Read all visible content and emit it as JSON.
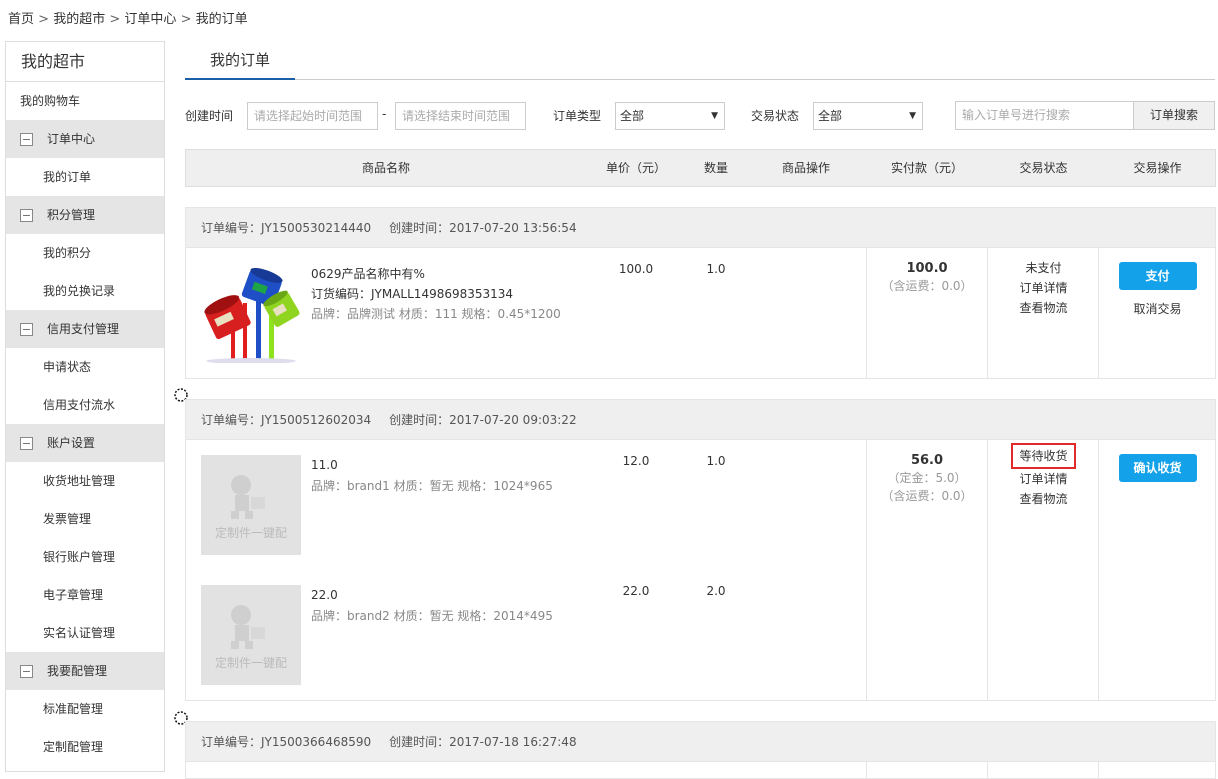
{
  "breadcrumb": [
    "首页",
    "我的超市",
    "订单中心",
    "我的订单"
  ],
  "sidebar": {
    "title": "我的超市",
    "cart": "我的购物车",
    "groups": [
      {
        "label": "订单中心",
        "toggle": "−",
        "items": [
          "我的订单"
        ]
      },
      {
        "label": "积分管理",
        "toggle": "−",
        "items": [
          "我的积分",
          "我的兑换记录"
        ]
      },
      {
        "label": "信用支付管理",
        "toggle": "−",
        "items": [
          "申请状态",
          "信用支付流水"
        ]
      },
      {
        "label": "账户设置",
        "toggle": "−",
        "items": [
          "收货地址管理",
          "发票管理",
          "银行账户管理",
          "电子章管理",
          "实名认证管理"
        ]
      },
      {
        "label": "我要配管理",
        "toggle": "−",
        "items": [
          "标准配管理",
          "定制配管理"
        ]
      }
    ]
  },
  "tab": {
    "active": "我的订单"
  },
  "filters": {
    "create_time_label": "创建时间",
    "start_placeholder": "请选择起始时间范围",
    "dash": "-",
    "end_placeholder": "请选择结束时间范围",
    "order_type_label": "订单类型",
    "order_type_value": "全部",
    "trade_status_label": "交易状态",
    "trade_status_value": "全部",
    "search_placeholder": "输入订单号进行搜索",
    "search_button": "订单搜索",
    "select_arrow": "▼"
  },
  "table_header": [
    "商品名称",
    "单价（元）",
    "数量",
    "商品操作",
    "实付款（元）",
    "交易状态",
    "交易操作"
  ],
  "orders": [
    {
      "order_no": "订单编号：JY1500530214440",
      "created": "创建时间：2017-07-20 13:56:54",
      "items": [
        {
          "name": "0629产品名称中有%",
          "code": "订货编码：JYMALL1498698353134",
          "meta": "品牌：品牌测试 材质：111 规格：0.45*1200",
          "price": "100.0",
          "qty": "1.0"
        }
      ],
      "amount": "100.0",
      "amount_notes": [
        "（含运费：0.0）"
      ],
      "status": "未支付",
      "detail": "订单详情",
      "logistics": "查看物流",
      "action_button": "支付",
      "cancel": "取消交易"
    },
    {
      "order_no": "订单编号：JY1500512602034",
      "created": "创建时间：2017-07-20 09:03:22",
      "items": [
        {
          "name": "11.0",
          "meta": "品牌：brand1 材质：暂无 规格：1024*965",
          "price": "12.0",
          "qty": "1.0",
          "placeholder": "定制件一键配"
        },
        {
          "name": "22.0",
          "meta": "品牌：brand2 材质：暂无 规格：2014*495",
          "price": "22.0",
          "qty": "2.0",
          "placeholder": "定制件一键配"
        }
      ],
      "amount": "56.0",
      "amount_notes": [
        "（定金：5.0）",
        "（含运费：0.0）"
      ],
      "status": "等待收货",
      "detail": "订单详情",
      "logistics": "查看物流",
      "action_button": "确认收货"
    },
    {
      "order_no": "订单编号：JY1500366468590",
      "created": "创建时间：2017-07-18 16:27:48"
    }
  ],
  "pin_icon_glyph": "定"
}
